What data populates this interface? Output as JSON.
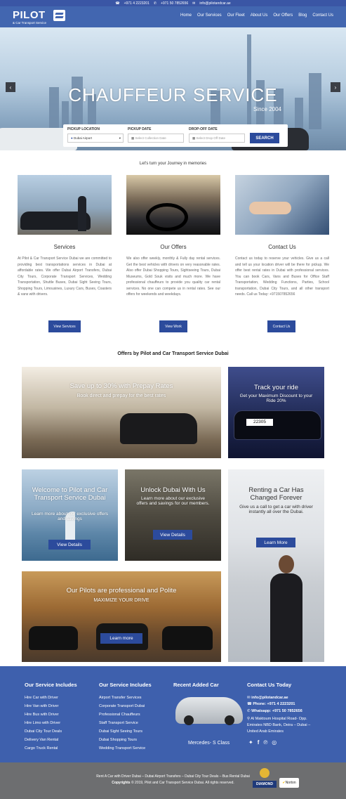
{
  "topbar": {
    "phone1": "+971 4 2223201",
    "phone2": "+971 50 7852656",
    "email": "info@pilotandcar.ae"
  },
  "logo": {
    "title": "PILOT",
    "subtitle": "& Car Transport Service"
  },
  "nav": [
    "Home",
    "Our Services",
    "Our Fleet",
    "About Us",
    "Our Offers",
    "Blog",
    "Contact Us"
  ],
  "hero": {
    "title": "CHAUFFEUR SERVICE",
    "subtitle": "Since 2004",
    "prev": "‹",
    "next": "›"
  },
  "search": {
    "pickup_location_label": "PICKUP LOCATION",
    "pickup_location_value": "Dubai Airport",
    "pickup_date_label": "PICKUP DATE",
    "pickup_date_placeholder": "Select Collection Date",
    "dropoff_date_label": "DROP-OFF DATE",
    "dropoff_date_placeholder": "Select Drop Off Date",
    "button": "SEARCH"
  },
  "tagline": "Let's turn your Journey in memories",
  "columns": [
    {
      "title": "Services",
      "text": "At Pilot & Car Transport Service Dubai we are committed to providing best transportations services in Dubai at affordable rates. We offer Dubai Airport Transfers, Dubai City Tours, Corporate Transport Services, Wedding Transportation, Shuttle Buses, Dubai Sight Seeing Tours, Shopping Tours, Limousines, Luxury Cars, Buses, Coasters & vans with drivers.",
      "button": "View Services"
    },
    {
      "title": "Our Offers",
      "text": "We also offer weekly, monthly & Fully day rental services. Get the best vehicles with drivers on very reasonable rates. Also offer Dubai Shopping Tours, Sightseeing Tours, Dubai Museums, Gold Souk visits and much more. We have professional chauffeurs to provide you quality car rental services. No one can compete us in rental rates. See our offers for weekends and weekdays.",
      "button": "View Work"
    },
    {
      "title": "Contact Us",
      "text": "Contact us today to reserve your vehicles. Give us a call and tell us your location driver will be there for pickup. We offer best rental rates in Dubai with professional services. You can book Cars, Vans and Buses for Office Staff Transportation, Wedding Functions, Parties, School transportation, Dubai City Tours, and all other transport needs. Call us Today: +971507852656",
      "button": "Contact Us"
    }
  ],
  "offers_heading": "Offers by Pilot and Car Transport Service Dubai",
  "offers": {
    "prepay_title": "Save up to 30% with Prepay Rates",
    "prepay_sub": "Book direct and prepay for the best rates",
    "track_title": "Track your ride",
    "track_sub": "Get your Maximum Discount to your Ride 20%",
    "plate": "22305",
    "welcome_title": "Welcome to Pilot and Car Transport Service Dubai",
    "welcome_sub": "Learn more about our exclusive offers and savings",
    "welcome_btn": "View Details",
    "unlock_title": "Unlock Dubai With Us",
    "unlock_sub": "Learn more about our exclusive offers and savings for our members.",
    "unlock_btn": "View Details",
    "renting_title": "Renting a Car Has Changed Forever",
    "renting_sub": "Give us a call to get a car with driver instantly all over the Dubai.",
    "renting_btn": "Learn More",
    "pilots_title": "Our Pilots are professional and Polite",
    "pilots_sub": "MAXIMIZE YOUR DRIVE",
    "pilots_btn": "Learn more"
  },
  "footer": {
    "col1_title": "Our Service Includes",
    "col1_items": [
      "Hire Car with Driver",
      "Hire Van with Driver",
      "Hire Bus with Driver",
      "Hire Limo with Driver",
      "Dubai City Tour Deals",
      "Delivery Van Rental",
      "Cargo Truck Rental"
    ],
    "col2_title": "Our Service Includes",
    "col2_items": [
      "Airport Transfer Services",
      "Corporate Transport Dubai",
      "Professional Chauffeurs",
      "Staff Transport Service",
      "Dubai Sight Seeing Tours",
      "Dubai Shopping Tours",
      "Wedding Transport Service"
    ],
    "col3_title": "Recent Added Car",
    "car_name": "Mercedes- S Class",
    "col4_title": "Contact Us Today",
    "email": "info@pilotandcar.ae",
    "phone": "Phone: +971 4 2223201",
    "whatsapp": "Whatsapp: +971 50 7852656",
    "address1": "Al Maktoum Hospital Road- Opp.",
    "address2": "Emirates NBD Bank, Deira – Dubai –",
    "address3": "United Arab Emirates"
  },
  "bottom": {
    "links": "Rent A Car with Driver Dubai – Dubai Airport Transfers –  Dubai City Tour Deals – Bus Rental Dubai",
    "copyright_bold": "Copyrights",
    "copyright_rest": " © 2019, Pilot and Car Transport Service Dubai. All rights reserved.",
    "badge1": "DIAMOND",
    "badge2": "Norton"
  }
}
